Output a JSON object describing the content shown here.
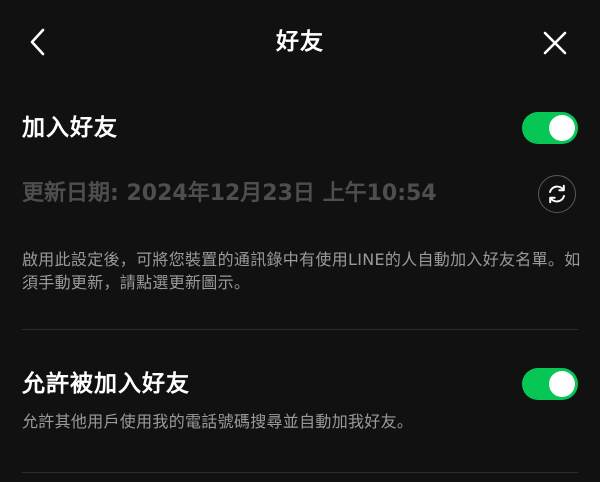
{
  "header": {
    "title": "好友",
    "back_icon": "chevron-left-icon",
    "close_icon": "close-icon"
  },
  "auto_add": {
    "label": "加入好友",
    "enabled": true,
    "last_updated": "更新日期: 2024年12月23日 上午10:54",
    "refresh_icon": "refresh-icon",
    "description": "啟用此設定後，可將您裝置的通訊錄中有使用LINE的人自動加入好友名單。如須手動更新，請點選更新圖示。"
  },
  "allow_add": {
    "label": "允許被加入好友",
    "enabled": true,
    "description": "允許其他用戶使用我的電話號碼搜尋並自動加我好友。"
  },
  "colors": {
    "background": "#111111",
    "toggle_on": "#06c755",
    "muted_text": "#4e4e4e",
    "description_text": "#9a9a9a"
  }
}
